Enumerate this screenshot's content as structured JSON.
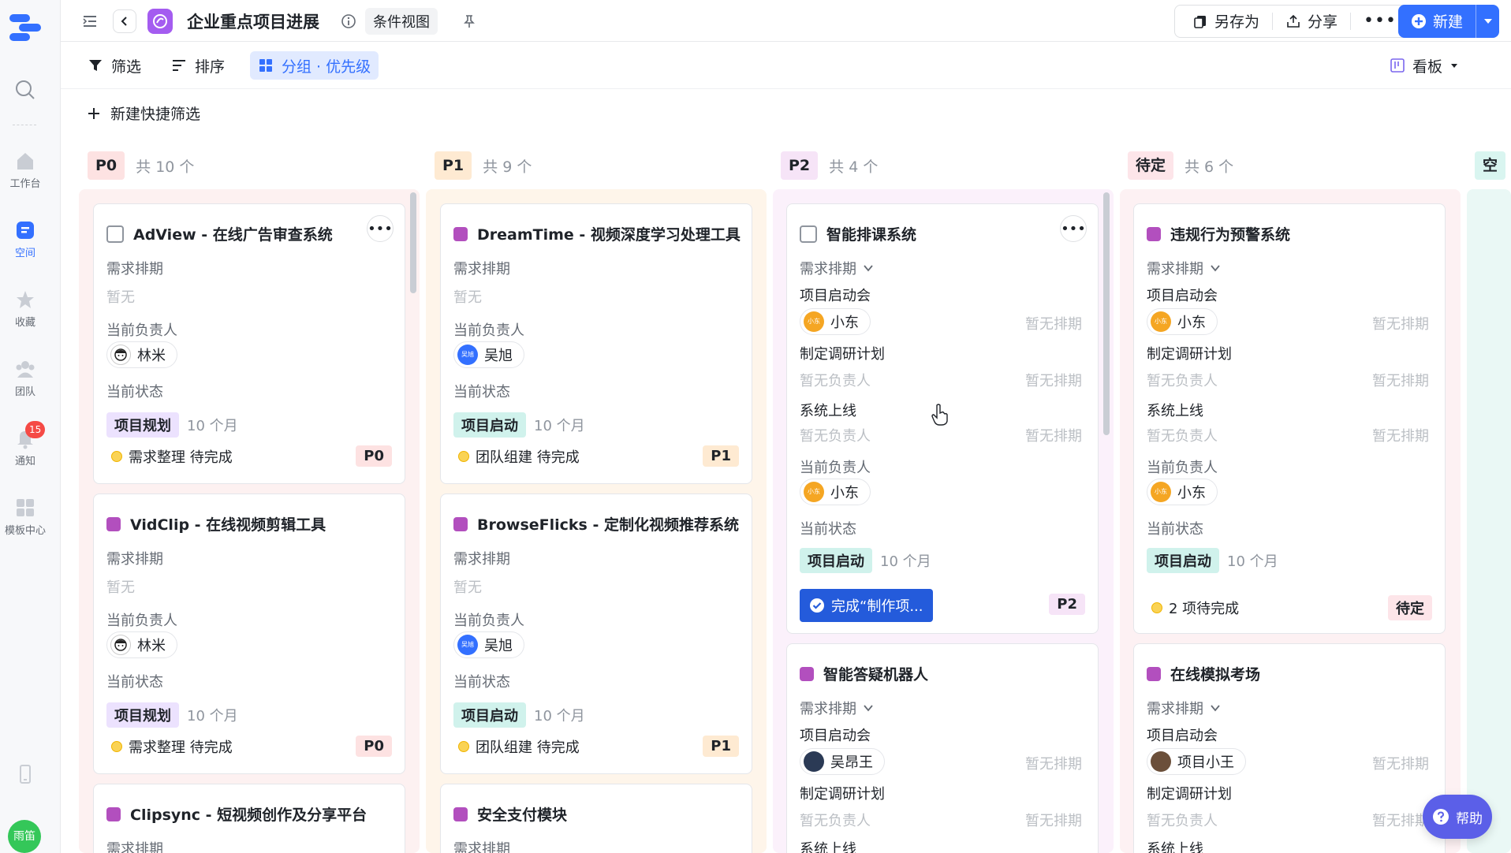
{
  "rail": {
    "items": [
      {
        "label": "工作台"
      },
      {
        "label": "空间"
      },
      {
        "label": "收藏"
      },
      {
        "label": "团队"
      },
      {
        "label": "通知"
      },
      {
        "label": "模板中心"
      }
    ],
    "notify_count": "15",
    "me": "雨笛"
  },
  "header": {
    "title": "企业重点项目进展",
    "view_tag": "条件视图",
    "save_as": "另存为",
    "share": "分享",
    "new": "新建"
  },
  "toolbar": {
    "filter": "筛选",
    "sort": "排序",
    "group": "分组 · 优先级",
    "view": "看板",
    "quick_filter": "新建快捷筛选"
  },
  "columns": [
    {
      "tag": "P0",
      "count": "共 10 个",
      "color": "#fde2e2"
    },
    {
      "tag": "P1",
      "count": "共 9 个",
      "color": "#feead2"
    },
    {
      "tag": "P2",
      "count": "共 4 个",
      "color": "#f6e4f7"
    },
    {
      "tag": "待定",
      "count": "共 6 个",
      "color": "#fde5e9"
    },
    {
      "tag": "空",
      "count": "",
      "color": "#d9f5f0"
    }
  ],
  "labels": {
    "schedule": "需求排期",
    "none": "暂无",
    "owner": "当前负责人",
    "state": "当前状态",
    "no_owner": "暂无负责人",
    "no_schedule": "暂无排期"
  },
  "cards": {
    "c1": {
      "title": "AdView - 在线广告审查系统",
      "owner": "林米",
      "status": "项目规划",
      "month": "10 个月",
      "foot": "需求整理 待完成",
      "p": "P0"
    },
    "c2": {
      "title": "VidClip - 在线视频剪辑工具",
      "owner": "林米",
      "status": "项目规划",
      "month": "10 个月",
      "foot": "需求整理 待完成",
      "p": "P0"
    },
    "c3": {
      "title": "Clipsync - 短视频创作及分享平台"
    },
    "c4": {
      "title": "DreamTime - 视频深度学习处理工具",
      "owner": "吴旭",
      "status": "项目启动",
      "month": "10 个月",
      "foot": "团队组建 待完成",
      "p": "P1"
    },
    "c5": {
      "title": "BrowseFlicks - 定制化视频推荐系统",
      "owner": "吴旭",
      "status": "项目启动",
      "month": "10 个月",
      "foot": "团队组建 待完成",
      "p": "P1"
    },
    "c6": {
      "title": "安全支付模块"
    },
    "c7": {
      "title": "智能排课系统",
      "t1": "项目启动会",
      "t1_owner": "小东",
      "t2": "制定调研计划",
      "t3": "系统上线",
      "owner": "小东",
      "status": "项目启动",
      "month": "10 个月",
      "done": "完成“制作项...",
      "p": "P2"
    },
    "c8": {
      "title": "智能答疑机器人",
      "t1": "项目启动会",
      "t1_owner": "吴昂王",
      "t2": "制定调研计划",
      "t3": "系统上线"
    },
    "c9": {
      "title": "违规行为预警系统",
      "t1": "项目启动会",
      "t1_owner": "小东",
      "t2": "制定调研计划",
      "t3": "系统上线",
      "owner": "小东",
      "status": "项目启动",
      "month": "10 个月",
      "foot": "2 项待完成",
      "p": "待定"
    },
    "c10": {
      "title": "在线模拟考场",
      "t1": "项目启动会",
      "t1_owner": "项目小王",
      "t2": "制定调研计划",
      "t3": "系统上线"
    }
  },
  "avatar_text": {
    "xiaodong": "小东",
    "wuxu": "吴旭"
  },
  "help": "帮助"
}
